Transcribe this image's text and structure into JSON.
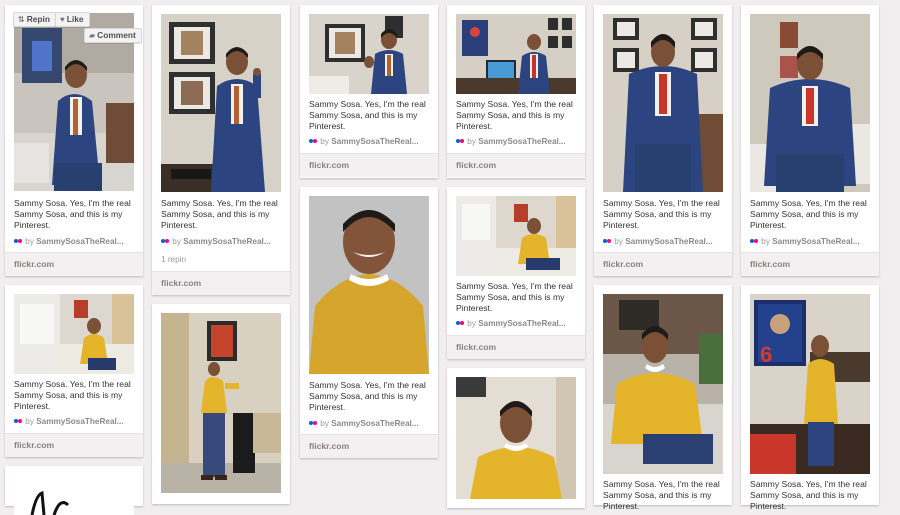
{
  "pin_common": {
    "description": "Sammy Sosa. Yes, I'm the real Sammy Sosa, and this is my Pinterest.",
    "by": "by",
    "pinner": "SammySosaTheReal...",
    "source": "flickr.com"
  },
  "actions": {
    "repin": "Repin",
    "like": "Like",
    "comment": "Comment"
  },
  "pins": {
    "p2": {
      "repins": "1 repin"
    }
  },
  "colors": {
    "background": "#f0eeee",
    "card": "#ffffff",
    "source_bar": "#f2f0f0",
    "source_text": "#8c7f7f",
    "flickr_blue": "#0063dc",
    "flickr_pink": "#ff0084"
  },
  "icons": {
    "repin": "repin-icon",
    "like": "heart-icon",
    "comment": "speech-bubble-icon",
    "source": "flickr-dots-icon"
  }
}
